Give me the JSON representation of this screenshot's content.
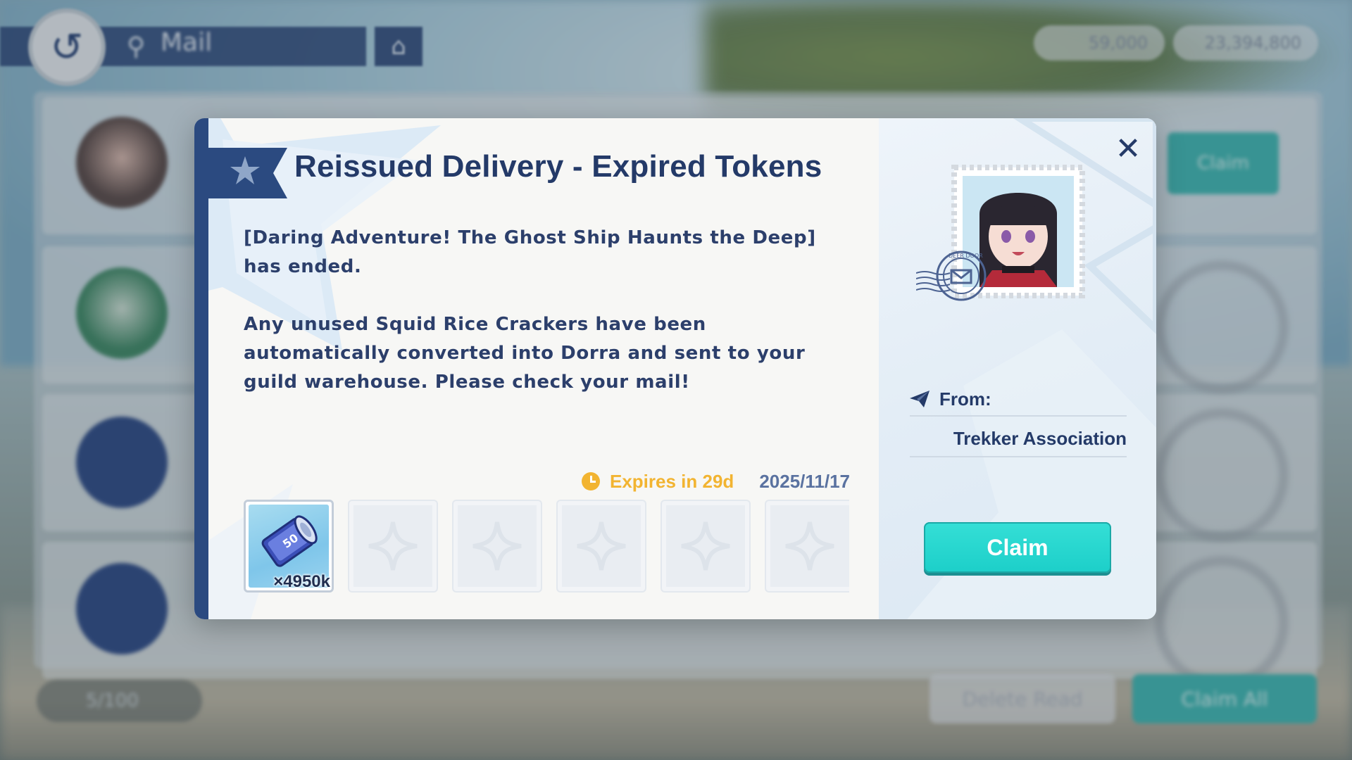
{
  "background": {
    "nav_title": "Mail",
    "currencies": [
      "59,000",
      "23,394,800"
    ],
    "list_claim_label": "Claim",
    "storage_count": "5/100",
    "delete_read_label": "Delete Read",
    "claim_all_label": "Claim All"
  },
  "mail": {
    "title": "Reissued Delivery - Expired Tokens",
    "body_paragraphs": [
      "[Daring Adventure! The Ghost Ship Haunts the Deep] has ended.",
      "Any unused Squid Rice Crackers have been automatically converted into Dorra and sent to your guild warehouse. Please check your mail!"
    ],
    "expires_label": "Expires in 29d",
    "date": "2025/11/17",
    "attachments": [
      {
        "icon": "dorra-coin-roll-icon",
        "quantity": "×4950k"
      }
    ],
    "empty_slot_count": 5,
    "from_label": "From:",
    "sender": "Trekker Association",
    "claim_label": "Claim",
    "postmark_text": "DEER DOOR"
  },
  "colors": {
    "navy": "#243a68",
    "accent_teal": "#1ccfc9",
    "expiry_gold": "#f2b431",
    "date_blue": "#5a72a0"
  }
}
